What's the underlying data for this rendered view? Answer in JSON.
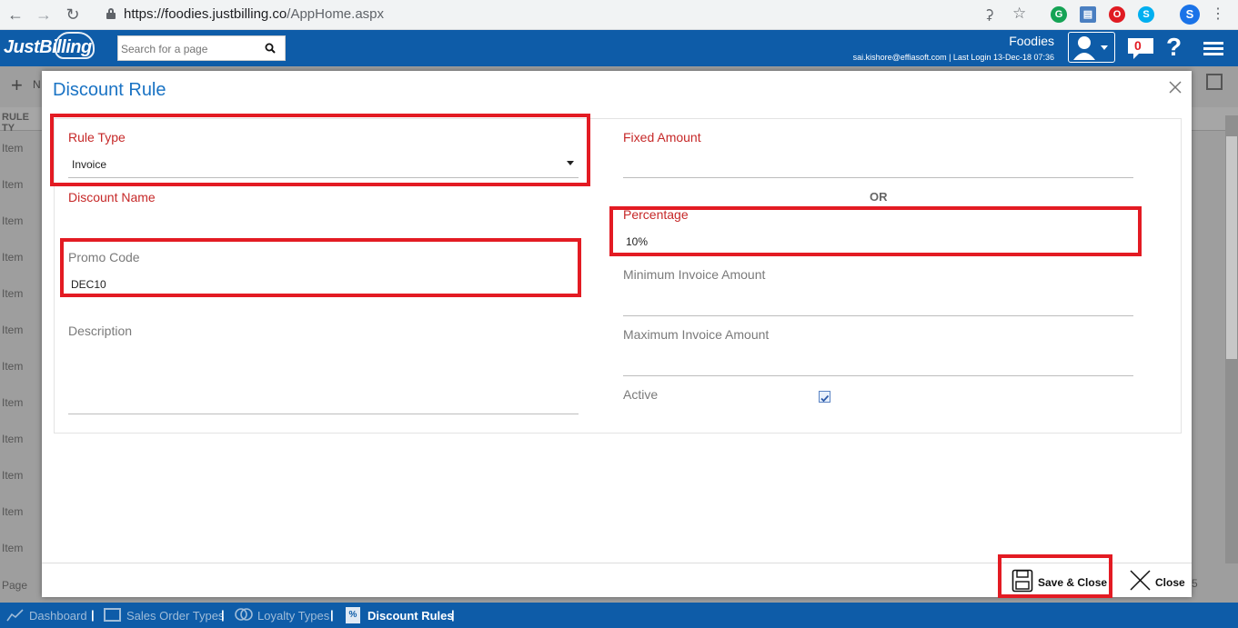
{
  "browser": {
    "url_host": "https://foodies.justbilling.co",
    "url_path": "/AppHome.aspx",
    "ext_skype_label": "S",
    "profile_label": "S"
  },
  "header": {
    "logo_text": "JustBilling",
    "search_placeholder": "Search for a page",
    "company": "Foodies",
    "login_info": "sai.kishore@effiasoft.com | Last Login 13-Dec-18 07:36",
    "notification_count": "0",
    "help_label": "?"
  },
  "background": {
    "new_label": "N",
    "column_header": "RULE TY",
    "rows": [
      "Item",
      "Item",
      "Item",
      "Item",
      "Item",
      "Item",
      "Item",
      "Item",
      "Item",
      "Item",
      "Item",
      "Item"
    ],
    "page_label": "Page",
    "page_size": "5"
  },
  "modal": {
    "title": "Discount Rule",
    "fields": {
      "rule_type": {
        "label": "Rule Type",
        "value": "Invoice"
      },
      "discount_name": {
        "label": "Discount Name",
        "value": ""
      },
      "promo_code": {
        "label": "Promo Code",
        "value": "DEC10"
      },
      "description": {
        "label": "Description",
        "value": ""
      },
      "fixed_amount": {
        "label": "Fixed Amount",
        "value": ""
      },
      "or_label": "OR",
      "percentage": {
        "label": "Percentage",
        "value": "10%"
      },
      "min_invoice": {
        "label": "Minimum Invoice Amount",
        "value": ""
      },
      "max_invoice": {
        "label": "Maximum Invoice Amount",
        "value": ""
      },
      "active": {
        "label": "Active",
        "checked": true
      }
    },
    "buttons": {
      "save_close": "Save & Close",
      "close": "Close"
    }
  },
  "footer": {
    "items": [
      "Dashboard",
      "Sales Order Types",
      "Loyalty Types",
      "Discount Rules"
    ]
  },
  "colors": {
    "brand_blue": "#0e5ca8",
    "label_red": "#c62828",
    "highlight_red": "#e31b23",
    "title_blue": "#1a73c4"
  }
}
